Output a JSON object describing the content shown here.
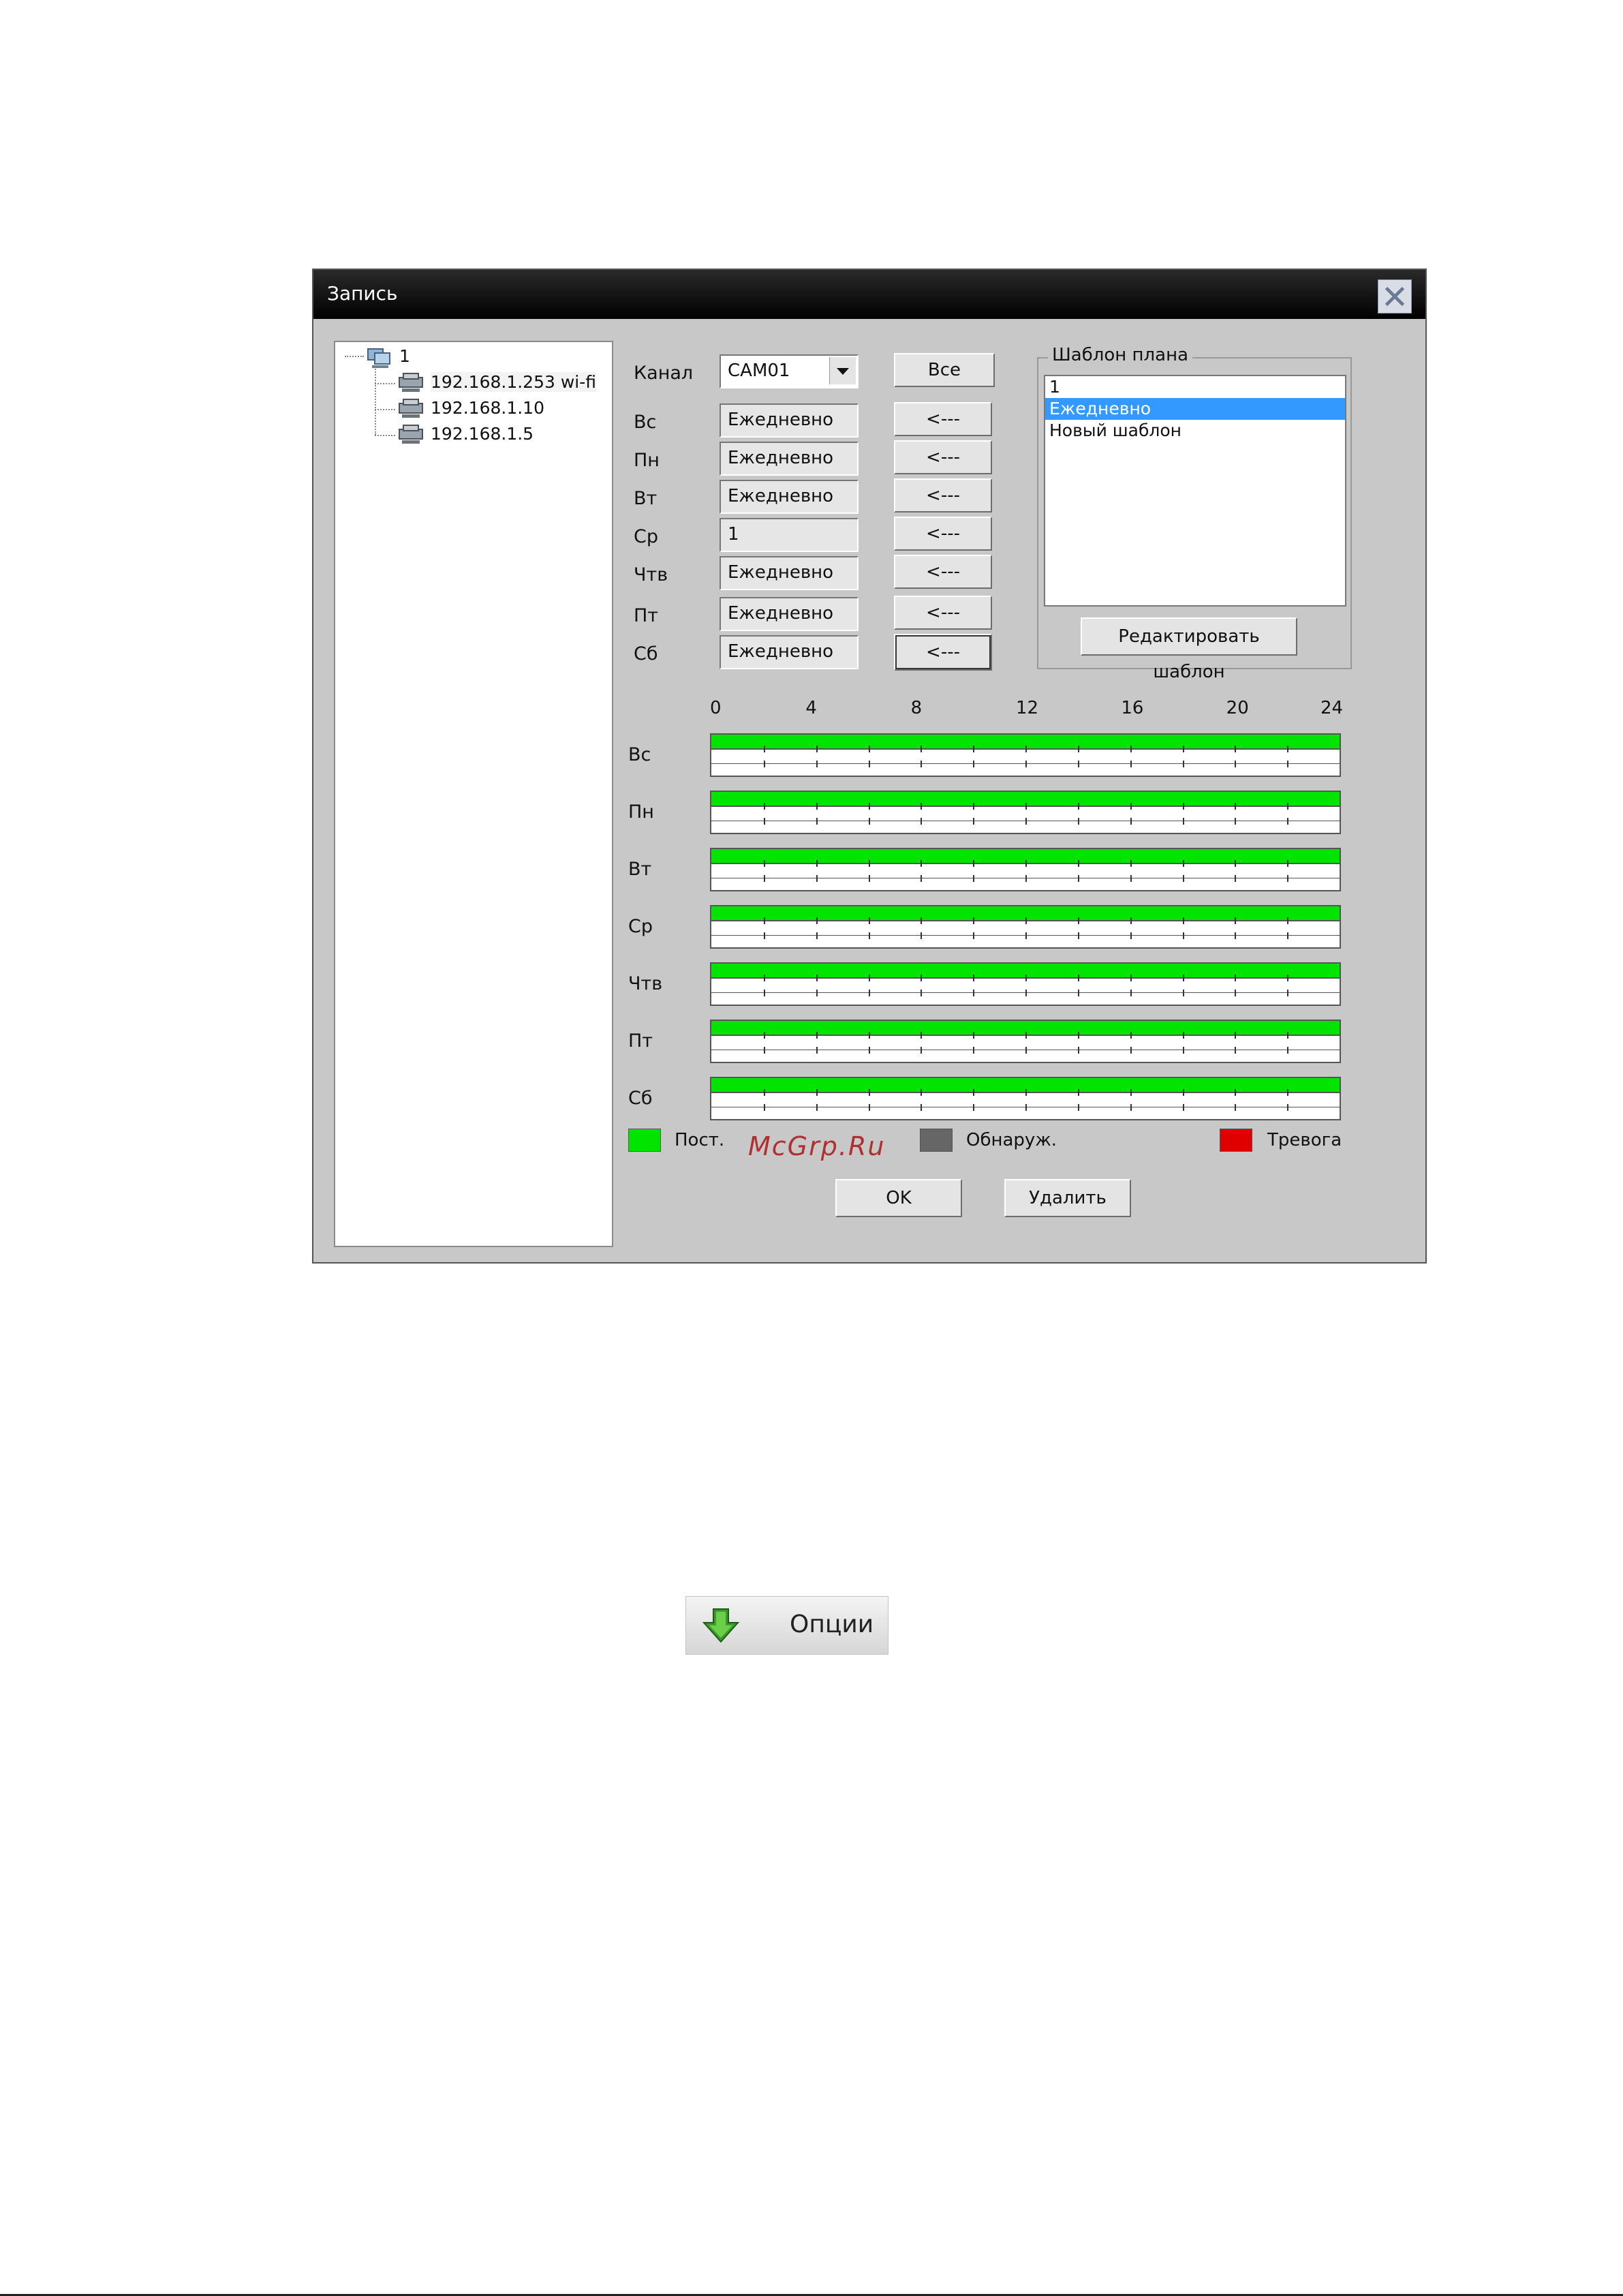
{
  "dialog": {
    "title": "Запись",
    "close_icon": "close-icon"
  },
  "tree": {
    "root_label": "1",
    "root_icon": "computer-group-icon",
    "nodes": [
      {
        "label": "192.168.1.253 wi-fi",
        "icon": "camera-device-icon"
      },
      {
        "label": "192.168.1.10",
        "icon": "camera-device-icon"
      },
      {
        "label": "192.168.1.5",
        "icon": "camera-device-icon"
      }
    ]
  },
  "channel": {
    "label": "Канал",
    "value": "CAM01",
    "all_button": "Все"
  },
  "days": [
    {
      "label": "Вс",
      "value": "Ежедневно",
      "button": "<---"
    },
    {
      "label": "Пн",
      "value": "Ежедневно",
      "button": "<---"
    },
    {
      "label": "Вт",
      "value": "Ежедневно",
      "button": "<---"
    },
    {
      "label": "Ср",
      "value": "1",
      "button": "<---"
    },
    {
      "label": "Чтв",
      "value": "Ежедневно",
      "button": "<---"
    },
    {
      "label": "Пт",
      "value": "Ежедневно",
      "button": "<---"
    },
    {
      "label": "Сб",
      "value": "Ежедневно",
      "button": "<---"
    }
  ],
  "template": {
    "title": "Шаблон плана",
    "items": [
      "1",
      "Ежедневно",
      "Новый шаблон"
    ],
    "selected_index": 1,
    "edit_button": "Редактировать шаблон"
  },
  "schedule": {
    "hour_ticks": [
      "0",
      "4",
      "8",
      "12",
      "16",
      "20",
      "24"
    ],
    "rows": [
      {
        "label": "Вс",
        "continuous": [
          0,
          24
        ]
      },
      {
        "label": "Пн",
        "continuous": [
          0,
          24
        ]
      },
      {
        "label": "Вт",
        "continuous": [
          0,
          24
        ]
      },
      {
        "label": "Ср",
        "continuous": [
          0,
          24
        ]
      },
      {
        "label": "Чтв",
        "continuous": [
          0,
          24
        ]
      },
      {
        "label": "Пт",
        "continuous": [
          0,
          24
        ]
      },
      {
        "label": "Сб",
        "continuous": [
          0,
          24
        ]
      }
    ]
  },
  "legend": {
    "continuous": {
      "label": "Пост.",
      "color": "#00e400"
    },
    "detect": {
      "label": "Обнаруж.",
      "color": "#666666"
    },
    "alarm": {
      "label": "Тревога",
      "color": "#e00000"
    }
  },
  "watermark": "McGrp.Ru",
  "buttons": {
    "ok": "OK",
    "delete": "Удалить"
  },
  "options_button": {
    "label": "Опции",
    "icon": "green-down-arrow-icon"
  }
}
